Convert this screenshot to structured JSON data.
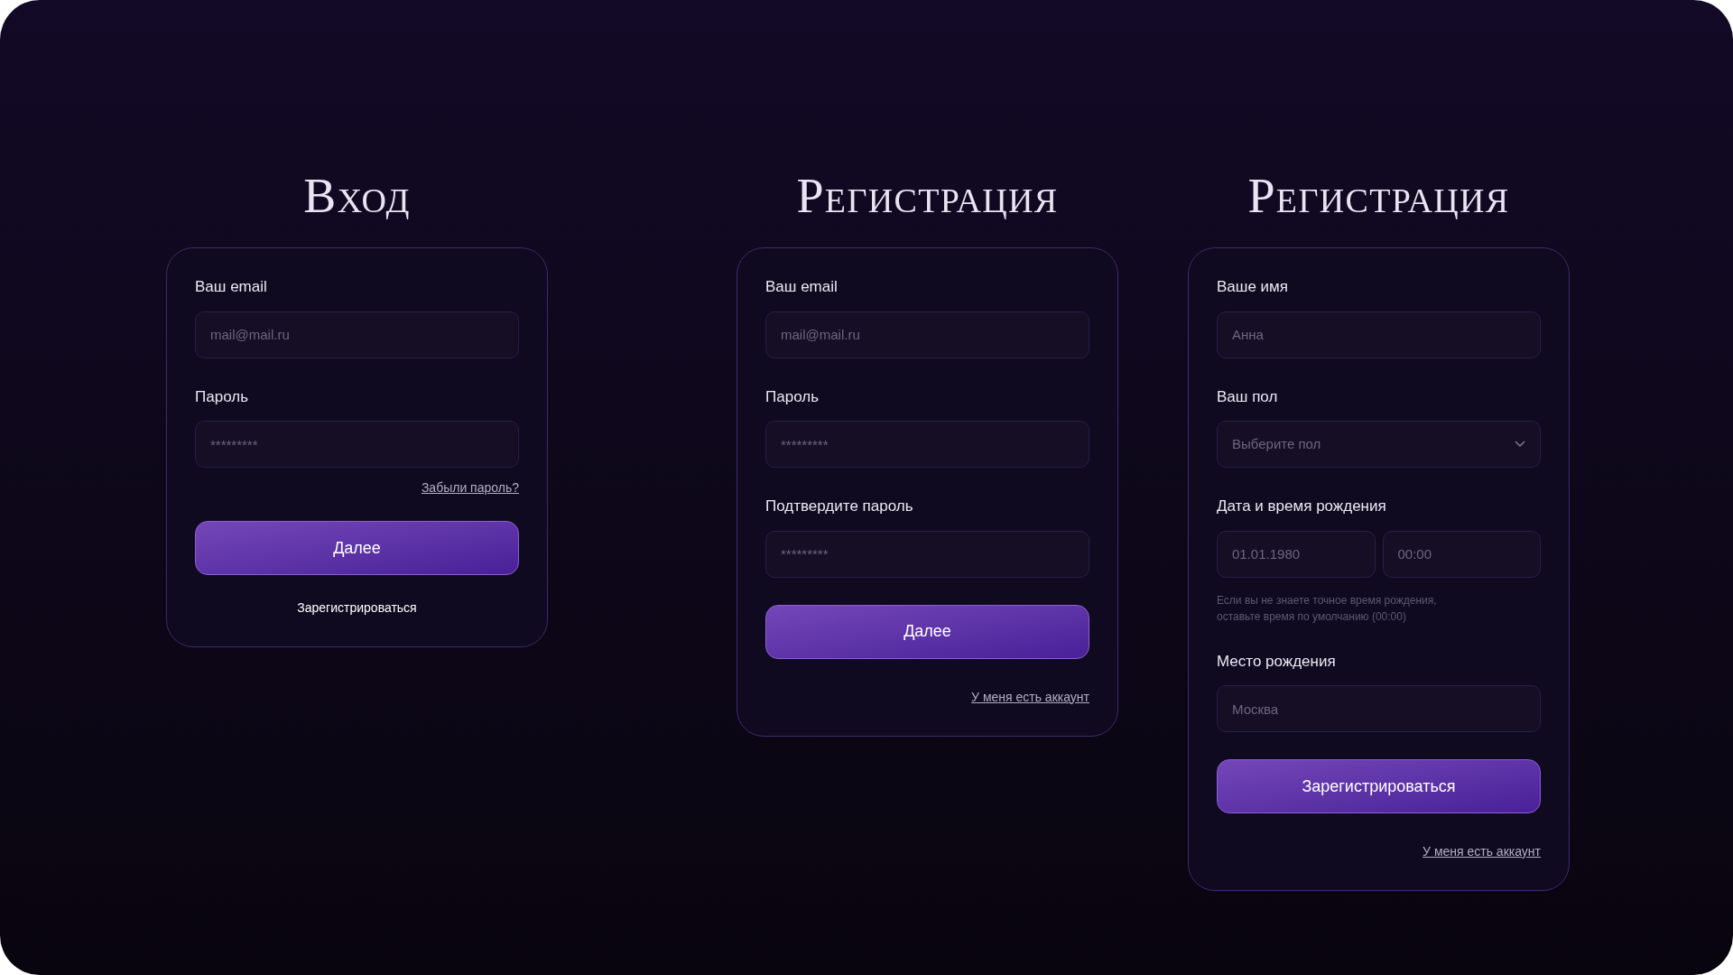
{
  "forms": [
    {
      "title": "Вход",
      "items": [
        {
          "kind": "field",
          "label": "Ваш email",
          "placeholder": "mail@mail.ru"
        },
        {
          "kind": "field",
          "label": "Пароль",
          "placeholder": "*********"
        },
        {
          "kind": "link",
          "text": "Забыли пароль?"
        },
        {
          "kind": "button",
          "text": "Далее"
        },
        {
          "kind": "text",
          "text": "Зарегистрироваться"
        }
      ]
    },
    {
      "title": "Регистрация",
      "items": [
        {
          "kind": "field",
          "label": "Ваш email",
          "placeholder": "mail@mail.ru"
        },
        {
          "kind": "field",
          "label": "Пароль",
          "placeholder": "*********"
        },
        {
          "kind": "field",
          "label": "Подтвердите пароль",
          "placeholder": "*********"
        },
        {
          "kind": "button",
          "text": "Далее"
        },
        {
          "kind": "link",
          "text": "У меня есть аккаунт"
        }
      ]
    },
    {
      "title": "Регистрация",
      "items": [
        {
          "kind": "field",
          "label": "Ваше имя",
          "placeholder": "Анна"
        },
        {
          "kind": "select",
          "label": "Ваш пол",
          "placeholder": "Выберите пол"
        },
        {
          "kind": "pair",
          "label": "Дата и время рождения",
          "placeholders": [
            "01.01.1980",
            "00:00"
          ]
        },
        {
          "kind": "hint",
          "lines": [
            "Если вы не знаете точное время рождения,",
            "оставьте время по умолчанию (00:00)"
          ]
        },
        {
          "kind": "field",
          "label": "Место рождения",
          "placeholder": "Москва"
        },
        {
          "kind": "button",
          "text": "Зарегистрироваться"
        },
        {
          "kind": "link",
          "text": "У меня есть аккаунт"
        }
      ]
    }
  ]
}
